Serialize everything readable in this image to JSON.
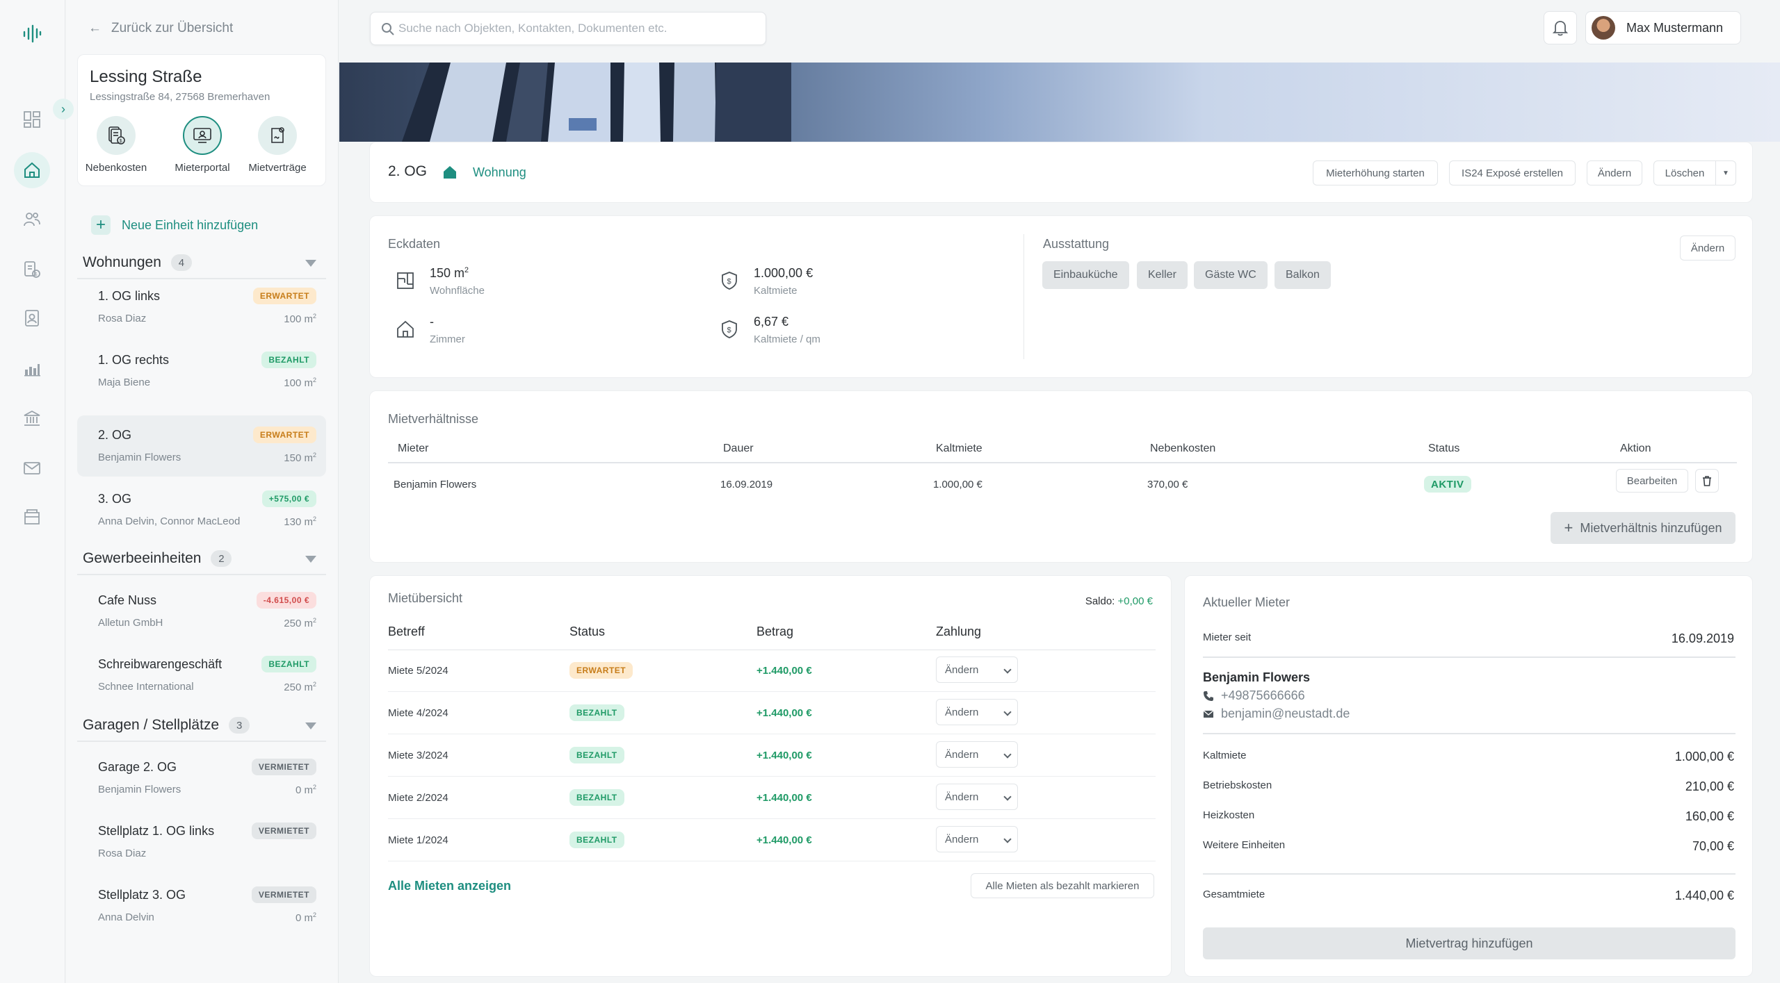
{
  "search": {
    "placeholder": "Suche nach Objekten, Kontakten, Dokumenten etc."
  },
  "user": {
    "name": "Max Mustermann"
  },
  "sidebar": {
    "back_label": "Zurück zur Übersicht",
    "property": {
      "name": "Lessing Straße",
      "address": "Lessingstraße 84, 27568 Bremerhaven"
    },
    "quick_actions": [
      "Nebenkosten",
      "Mieterportal",
      "Mietverträge"
    ],
    "add_unit_label": "Neue Einheit hinzufügen",
    "groups": [
      {
        "title": "Wohnungen",
        "count": "4",
        "units": [
          {
            "name": "1. OG links",
            "tenant": "Rosa Diaz",
            "area": "100 m",
            "badge": "ERWARTET",
            "badge_type": "warn"
          },
          {
            "name": "1. OG rechts",
            "tenant": "Maja Biene",
            "area": "100 m",
            "badge": "BEZAHLT",
            "badge_type": "ok"
          },
          {
            "name": "2. OG",
            "tenant": "Benjamin Flowers",
            "area": "150 m",
            "badge": "ERWARTET",
            "badge_type": "warn"
          },
          {
            "name": "3. OG",
            "tenant": "Anna Delvin, Connor MacLeod",
            "area": "130 m",
            "badge": "+575,00 €",
            "badge_type": "green"
          }
        ]
      },
      {
        "title": "Gewerbeeinheiten",
        "count": "2",
        "units": [
          {
            "name": "Cafe Nuss",
            "tenant": "Alletun GmbH",
            "area": "250 m",
            "badge": "-4.615,00 €",
            "badge_type": "red"
          },
          {
            "name": "Schreibwarengeschäft",
            "tenant": "Schnee International",
            "area": "250 m",
            "badge": "BEZAHLT",
            "badge_type": "ok"
          }
        ]
      },
      {
        "title": "Garagen / Stellplätze",
        "count": "3",
        "units": [
          {
            "name": "Garage 2. OG",
            "tenant": "Benjamin Flowers",
            "area": "0 m",
            "badge": "VERMIETET",
            "badge_type": "grey"
          },
          {
            "name": "Stellplatz 1. OG links",
            "tenant": "Rosa Diaz",
            "area": "",
            "badge": "VERMIETET",
            "badge_type": "grey"
          },
          {
            "name": "Stellplatz 3. OG",
            "tenant": "Anna Delvin",
            "area": "0 m",
            "badge": "VERMIETET",
            "badge_type": "grey"
          }
        ]
      }
    ]
  },
  "unit_header": {
    "name": "2. OG",
    "type": "Wohnung",
    "buttons": [
      "Mieterhöhung starten",
      "IS24 Exposé erstellen",
      "Ändern",
      "Löschen"
    ]
  },
  "eckdaten": {
    "title": "Eckdaten",
    "items": [
      {
        "value": "150 m",
        "label": "Wohnfläche"
      },
      {
        "value": "1.000,00 €",
        "label": "Kaltmiete"
      },
      {
        "value": "-",
        "label": "Zimmer"
      },
      {
        "value": "6,67 €",
        "label": "Kaltmiete / qm"
      }
    ]
  },
  "ausstattung": {
    "title": "Ausstattung",
    "edit_label": "Ändern",
    "features": [
      "Einbauküche",
      "Keller",
      "Gäste WC",
      "Balkon"
    ]
  },
  "mietverhaeltnisse": {
    "title": "Mietverhältnisse",
    "columns": [
      "Mieter",
      "Dauer",
      "Kaltmiete",
      "Nebenkosten",
      "Status",
      "Aktion"
    ],
    "rows": [
      {
        "mieter": "Benjamin Flowers",
        "dauer": "16.09.2019",
        "kaltmiete": "1.000,00 €",
        "nebenkosten": "370,00 €",
        "status": "AKTIV",
        "action": "Bearbeiten"
      }
    ],
    "add_label": "Mietverhältnis hinzufügen"
  },
  "mietuebersicht": {
    "title": "Mietübersicht",
    "saldo_label": "Saldo:",
    "saldo_value": "+0,00 €",
    "columns": [
      "Betreff",
      "Status",
      "Betrag",
      "Zahlung"
    ],
    "rows": [
      {
        "betreff": "Miete 5/2024",
        "status": "ERWARTET",
        "status_type": "warn",
        "betrag": "+1.440,00 €",
        "zahlung": "Ändern"
      },
      {
        "betreff": "Miete 4/2024",
        "status": "BEZAHLT",
        "status_type": "ok",
        "betrag": "+1.440,00 €",
        "zahlung": "Ändern"
      },
      {
        "betreff": "Miete 3/2024",
        "status": "BEZAHLT",
        "status_type": "ok",
        "betrag": "+1.440,00 €",
        "zahlung": "Ändern"
      },
      {
        "betreff": "Miete 2/2024",
        "status": "BEZAHLT",
        "status_type": "ok",
        "betrag": "+1.440,00 €",
        "zahlung": "Ändern"
      },
      {
        "betreff": "Miete 1/2024",
        "status": "BEZAHLT",
        "status_type": "ok",
        "betrag": "+1.440,00 €",
        "zahlung": "Ändern"
      }
    ],
    "show_all_label": "Alle Mieten anzeigen",
    "mark_paid_label": "Alle Mieten als bezahlt markieren"
  },
  "aktueller_mieter": {
    "title": "Aktueller Mieter",
    "since_label": "Mieter seit",
    "since_value": "16.09.2019",
    "name": "Benjamin Flowers",
    "phone": "+49875666666",
    "email": "benjamin@neustadt.de",
    "costs": [
      {
        "label": "Kaltmiete",
        "value": "1.000,00 €"
      },
      {
        "label": "Betriebskosten",
        "value": "210,00 €"
      },
      {
        "label": "Heizkosten",
        "value": "160,00 €"
      },
      {
        "label": "Weitere Einheiten",
        "value": "70,00 €"
      }
    ],
    "total_label": "Gesamtmiete",
    "total_value": "1.440,00 €",
    "add_contract_label": "Mietvertrag hinzufügen"
  },
  "colors": {
    "accent": "#1e8e80",
    "accent_light": "#e3f3f1",
    "warn": "#c77d1a",
    "ok": "#1f9a66",
    "danger": "#d04b4b"
  },
  "icons": {
    "rail": [
      "logo-icon",
      "dashboard-icon",
      "home-icon",
      "users-icon",
      "documents-icon",
      "contacts-icon",
      "chart-icon",
      "bank-icon",
      "mail-icon",
      "archive-icon"
    ],
    "quick_actions": [
      "nebenkosten-icon",
      "mieterportal-icon",
      "mietvertraege-icon"
    ]
  }
}
